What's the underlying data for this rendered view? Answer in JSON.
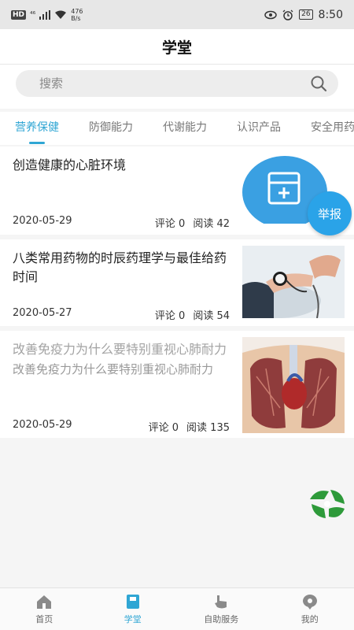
{
  "status": {
    "network_badge": "HD",
    "signal": "⁴⁶",
    "speed_value": "476",
    "speed_unit": "B/s",
    "battery": "26",
    "time": "8:50"
  },
  "header": {
    "title": "学堂"
  },
  "search": {
    "placeholder": "搜索"
  },
  "tabs": [
    "营养保健",
    "防御能力",
    "代谢能力",
    "认识产品",
    "安全用药"
  ],
  "articles": [
    {
      "title": "创造健康的心脏环境",
      "summary": "",
      "date": "2020-05-29",
      "comments": "评论 0",
      "reads": "阅读 42",
      "thumb": "medicine-cabinet-icon"
    },
    {
      "title": "八类常用药物的时辰药理学与最佳给药时间",
      "summary": "",
      "date": "2020-05-27",
      "comments": "评论 0",
      "reads": "阅读 54",
      "thumb": "blood-pressure-photo"
    },
    {
      "title": "改善免疫力为什么要特别重视心肺耐力",
      "summary": "改善免疫力为什么要特别重视心肺耐力",
      "date": "2020-05-29",
      "comments": "评论 0",
      "reads": "阅读 135",
      "thumb": "lungs-illustration"
    }
  ],
  "report_button": "举报",
  "tabbar": [
    {
      "label": "首页",
      "icon": "home-icon"
    },
    {
      "label": "学堂",
      "icon": "book-icon"
    },
    {
      "label": "自助服务",
      "icon": "hand-icon"
    },
    {
      "label": "我的",
      "icon": "profile-icon"
    }
  ],
  "colors": {
    "accent": "#2fa6d4",
    "report": "#2aa3e8",
    "logo": "#2e9a3a"
  }
}
